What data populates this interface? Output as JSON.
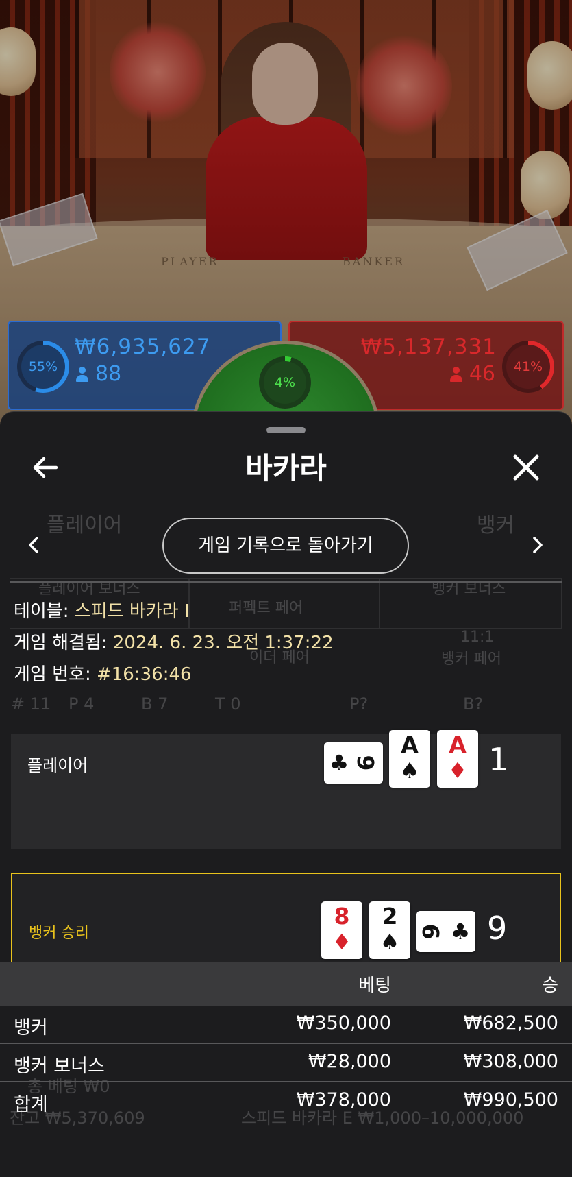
{
  "video": {
    "table_labels": {
      "player": "PLAYER",
      "banker": "BANKER"
    }
  },
  "bet_pools": {
    "player": {
      "percent": "55%",
      "amount": "₩6,935,627",
      "count": "88",
      "color": "#2b6bd0"
    },
    "tie": {
      "percent": "4%",
      "color": "#33cc33"
    },
    "banker": {
      "percent": "41%",
      "amount": "₩5,137,331",
      "count": "46",
      "color": "#c02a2a"
    }
  },
  "sheet": {
    "title": "바카라",
    "back_icon": "arrow-left-icon",
    "close_icon": "close-x-icon",
    "return_button": "게임 기록으로 돌아가기",
    "info": {
      "table_label": "테이블:",
      "table_value": "스피드 바카라 I",
      "resolved_label": "게임 해결됨:",
      "resolved_value": "2024. 6. 23. 오전 1:37:22",
      "number_label": "게임 번호:",
      "number_value": "#16:36:46"
    },
    "hands": {
      "player": {
        "label": "플레이어",
        "total": "1",
        "cards": [
          {
            "rank": "9",
            "suit": "♣",
            "color": "black",
            "sideways": true
          },
          {
            "rank": "A",
            "suit": "♠",
            "color": "black",
            "sideways": false
          },
          {
            "rank": "A",
            "suit": "♦",
            "color": "red",
            "sideways": false
          }
        ]
      },
      "banker": {
        "label": "뱅커 승리",
        "total": "9",
        "cards": [
          {
            "rank": "8",
            "suit": "♦",
            "color": "red",
            "sideways": false
          },
          {
            "rank": "2",
            "suit": "♠",
            "color": "black",
            "sideways": false
          },
          {
            "rank": "9",
            "suit": "♣",
            "color": "black",
            "sideways": true
          }
        ]
      }
    },
    "result_table": {
      "headers": {
        "bet": "베팅",
        "win": "승"
      },
      "rows": [
        {
          "name": "뱅커",
          "bet": "₩350,000",
          "win": "₩682,500"
        },
        {
          "name": "뱅커 보너스",
          "bet": "₩28,000",
          "win": "₩308,000"
        }
      ],
      "total": {
        "name": "합계",
        "bet": "₩378,000",
        "win": "₩990,500"
      }
    }
  },
  "background_ghost": {
    "player": "플레이어",
    "banker": "뱅커",
    "player_bonus": "플레이어 보너스",
    "banker_bonus": "뱅커 보너스",
    "perfect_pair": "퍼펙트 페어",
    "either_pair": "이더 페어",
    "banker_pair_odds": "11:1",
    "banker_pair": "뱅커 페어",
    "stats": [
      "# 11",
      "P 4",
      "B 7",
      "T 0",
      "P?",
      "B?"
    ],
    "balance": "잔고 ₩5,370,609",
    "table_limit": "스피드 바카라 E ₩1,000–10,000,000",
    "total_bet": "총 베팅 ₩0"
  }
}
